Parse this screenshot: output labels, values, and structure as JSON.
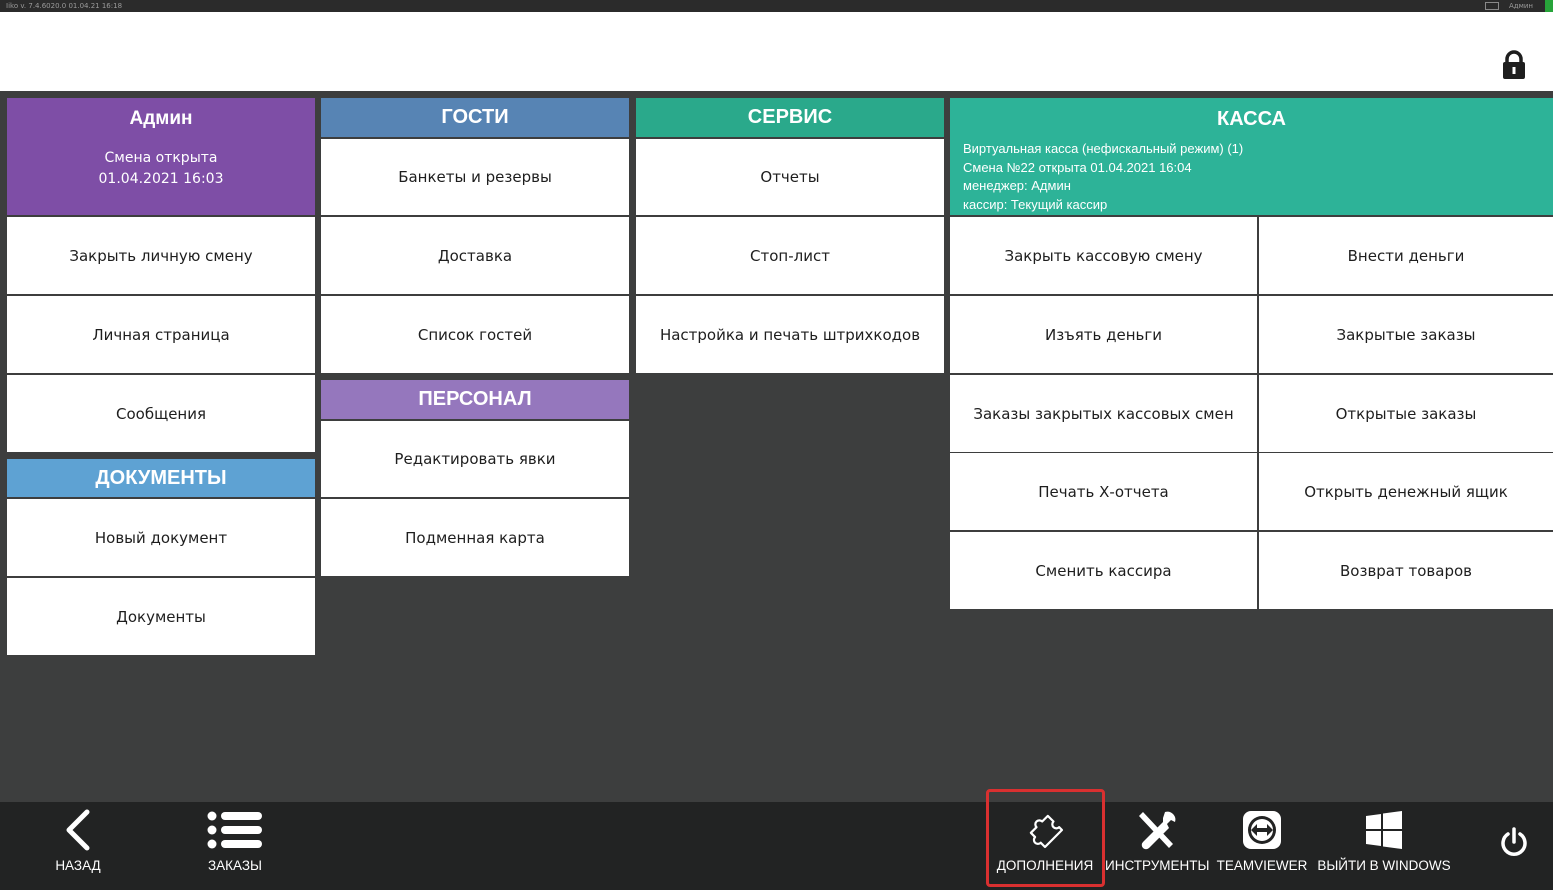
{
  "status": {
    "left_text": "Iiko  v. 7.4.6020.0    01.04.21   16:18",
    "user": "Админ"
  },
  "admin": {
    "title": "Админ",
    "shift_status": "Смена открыта",
    "shift_time": "01.04.2021 16:03",
    "items": [
      "Закрыть личную смену",
      "Личная страница",
      "Сообщения"
    ]
  },
  "documents": {
    "title": "ДОКУМЕНТЫ",
    "items": [
      "Новый документ",
      "Документы"
    ]
  },
  "guests": {
    "title": "ГОСТИ",
    "items": [
      "Банкеты и резервы",
      "Доставка",
      "Список гостей"
    ]
  },
  "staff": {
    "title": "ПЕРСОНАЛ",
    "items": [
      "Редактировать явки",
      "Подменная карта"
    ]
  },
  "service": {
    "title": "СЕРВИС",
    "items": [
      "Отчеты",
      "Стоп-лист",
      "Настройка и печать штрихкодов"
    ]
  },
  "kassa": {
    "title": "КАССА",
    "info": [
      "Виртуальная касса (нефискальный режим) (1)",
      "Смена №22 открыта 01.04.2021 16:04",
      "менеджер: Админ",
      "кассир: Текущий кассир"
    ],
    "left_items": [
      "Закрыть кассовую смену",
      "Изъять деньги",
      "Заказы закрытых кассовых смен",
      "Печать Х-отчета",
      "Сменить кассира"
    ],
    "right_items": [
      "Внести деньги",
      "Закрытые заказы",
      "Открытые заказы",
      "Открыть денежный ящик",
      "Возврат товаров"
    ]
  },
  "colors": {
    "admin": "#7e4ea6",
    "documents": "#5ea2d3",
    "guests": "#5784b4",
    "staff": "#9577bd",
    "service": "#2aa98b",
    "kassa": "#2db398",
    "highlight": "#d93030"
  },
  "bottom": {
    "back": "НАЗАД",
    "orders": "ЗАКАЗЫ",
    "addons": "ДОПОЛНЕНИЯ",
    "tools": "ИНСТРУМЕНТЫ",
    "teamviewer": "TEAMVIEWER",
    "windows": "ВЫЙТИ В WINDOWS"
  },
  "icons": {
    "lock": "lock-icon",
    "back": "chevron-left-icon",
    "orders": "list-icon",
    "addons": "puzzle-icon",
    "tools": "tools-icon",
    "teamviewer": "teamviewer-icon",
    "windows": "windows-icon",
    "power": "power-icon",
    "mail": "mail-icon"
  }
}
